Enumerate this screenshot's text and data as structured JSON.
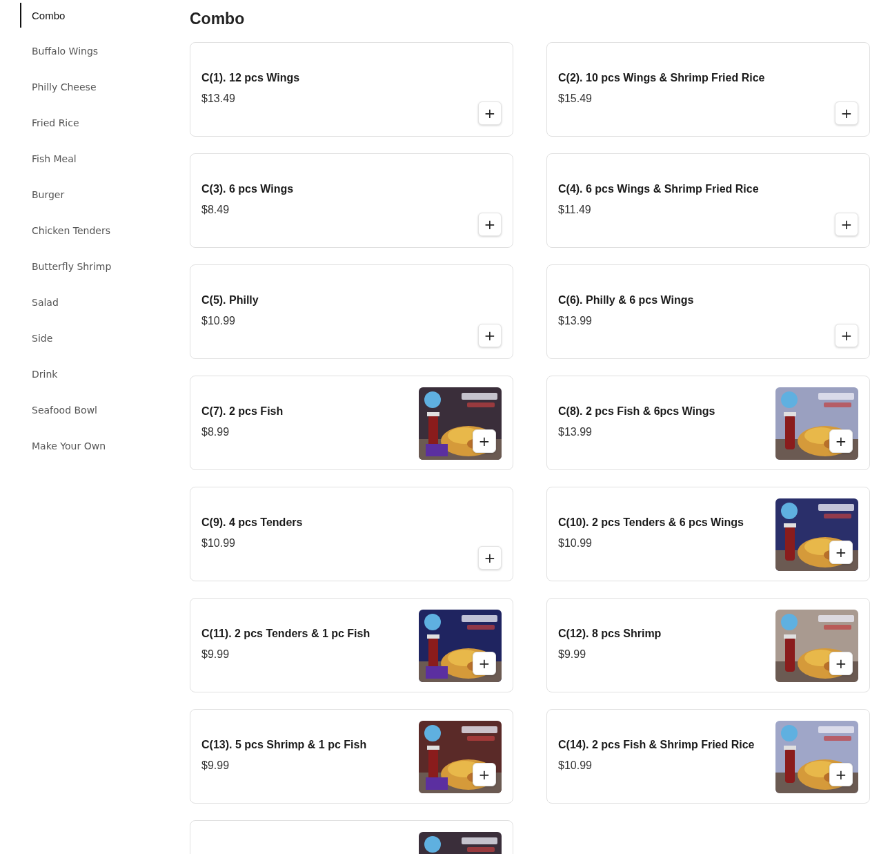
{
  "sidebar": {
    "items": [
      {
        "label": "Combo",
        "selected": true
      },
      {
        "label": "Buffalo Wings",
        "selected": false
      },
      {
        "label": "Philly Cheese",
        "selected": false
      },
      {
        "label": "Fried Rice",
        "selected": false
      },
      {
        "label": "Fish Meal",
        "selected": false
      },
      {
        "label": "Burger",
        "selected": false
      },
      {
        "label": "Chicken Tenders",
        "selected": false
      },
      {
        "label": "Butterfly Shrimp",
        "selected": false
      },
      {
        "label": "Salad",
        "selected": false
      },
      {
        "label": "Side",
        "selected": false
      },
      {
        "label": "Drink",
        "selected": false
      },
      {
        "label": "Seafood Bowl",
        "selected": false
      },
      {
        "label": "Make Your Own",
        "selected": false
      }
    ]
  },
  "section": {
    "title": "Combo",
    "items": [
      {
        "name": "C(1). 12 pcs Wings",
        "price": "$13.49",
        "add": "+"
      },
      {
        "name": "C(2). 10 pcs Wings & Shrimp Fried Rice",
        "price": "$15.49",
        "add": "+"
      },
      {
        "name": "C(3). 6 pcs Wings",
        "price": "$8.49",
        "add": "+"
      },
      {
        "name": "C(4). 6 pcs Wings & Shrimp Fried Rice",
        "price": "$11.49",
        "add": "+"
      },
      {
        "name": "C(5). Philly",
        "price": "$10.99",
        "add": "+"
      },
      {
        "name": "C(6). Philly & 6 pcs Wings",
        "price": "$13.99",
        "add": "+"
      },
      {
        "name": "C(7). 2 pcs Fish",
        "price": "$8.99",
        "add": "+",
        "image": {
          "kind": "picture"
        }
      },
      {
        "name": "C(8). 2 pcs Fish & 6pcs Wings",
        "price": "$13.99",
        "add": "+",
        "image": {
          "kind": "picture"
        }
      },
      {
        "name": "C(9). 4 pcs Tenders",
        "price": "$10.99",
        "add": "+"
      },
      {
        "name": "C(10). 2 pcs Tenders & 6 pcs Wings",
        "price": "$10.99",
        "add": "+",
        "image": {
          "kind": "picture"
        }
      },
      {
        "name": "C(11). 2 pcs Tenders & 1 pc Fish",
        "price": "$9.99",
        "add": "+",
        "image": {
          "kind": "picture"
        }
      },
      {
        "name": "C(12). 8 pcs Shrimp",
        "price": "$9.99",
        "add": "+",
        "image": {
          "kind": "picture"
        }
      },
      {
        "name": "C(13). 5 pcs Shrimp & 1 pc Fish",
        "price": "$9.99",
        "add": "+",
        "image": {
          "kind": "picture"
        }
      },
      {
        "name": "C(14). 2 pcs Fish & Shrimp Fried Rice",
        "price": "$10.99",
        "add": "+",
        "image": {
          "kind": "picture"
        }
      },
      {
        "image": {
          "kind": "picture"
        }
      }
    ]
  }
}
